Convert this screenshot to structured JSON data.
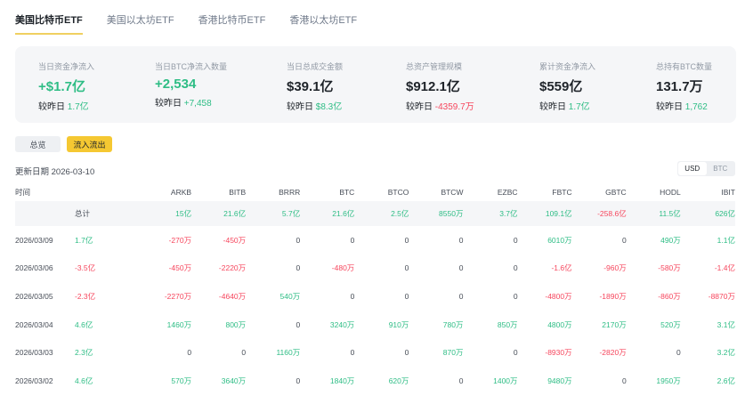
{
  "tabs": [
    "美国比特币ETF",
    "美国以太坊ETF",
    "香港比特币ETF",
    "香港以太坊ETF"
  ],
  "stats": [
    {
      "label": "当日资金净流入",
      "value": "+$1.7亿",
      "value_color": "g",
      "compare_label": "较昨日",
      "compare": "1.7亿",
      "compare_color": "g"
    },
    {
      "label": "当日BTC净流入数量",
      "value": "+2,534",
      "value_color": "g",
      "compare_label": "较昨日",
      "compare": "+7,458",
      "compare_color": "g"
    },
    {
      "label": "当日总成交金额",
      "value": "$39.1亿",
      "value_color": "",
      "compare_label": "较昨日",
      "compare": "$8.3亿",
      "compare_color": "g"
    },
    {
      "label": "总资产管理规模",
      "value": "$912.1亿",
      "value_color": "",
      "compare_label": "较昨日",
      "compare": "-4359.7万",
      "compare_color": "r"
    },
    {
      "label": "累计资金净流入",
      "value": "$559亿",
      "value_color": "",
      "compare_label": "较昨日",
      "compare": "1.7亿",
      "compare_color": "g"
    },
    {
      "label": "总持有BTC数量",
      "value": "131.7万",
      "value_color": "",
      "compare_label": "较昨日",
      "compare": "1,762",
      "compare_color": "g"
    }
  ],
  "buttons": {
    "overview": "总览",
    "flows": "流入流出"
  },
  "update": "更新日期 2026-03-10",
  "toggle": {
    "usd": "USD",
    "btc": "BTC"
  },
  "table": {
    "headers": [
      "时间",
      "",
      "ARKB",
      "BITB",
      "BRRR",
      "BTC",
      "BTCO",
      "BTCW",
      "EZBC",
      "FBTC",
      "GBTC",
      "HODL",
      "IBIT"
    ],
    "rows": [
      [
        "",
        "总计",
        "15亿",
        "21.6亿",
        "5.7亿",
        "21.6亿",
        "2.5亿",
        "8550万",
        "3.7亿",
        "109.1亿",
        "-258.6亿",
        "11.5亿",
        "626亿"
      ],
      [
        "2026/03/09",
        "1.7亿",
        "-270万",
        "-450万",
        "0",
        "0",
        "0",
        "0",
        "0",
        "6010万",
        "0",
        "490万",
        "1.1亿"
      ],
      [
        "2026/03/06",
        "-3.5亿",
        "-450万",
        "-2220万",
        "0",
        "-480万",
        "0",
        "0",
        "0",
        "-1.6亿",
        "-960万",
        "-580万",
        "-1.4亿"
      ],
      [
        "2026/03/05",
        "-2.3亿",
        "-2270万",
        "-4640万",
        "540万",
        "0",
        "0",
        "0",
        "0",
        "-4800万",
        "-1890万",
        "-860万",
        "-8870万"
      ],
      [
        "2026/03/04",
        "4.6亿",
        "1460万",
        "800万",
        "0",
        "3240万",
        "910万",
        "780万",
        "850万",
        "4800万",
        "2170万",
        "520万",
        "3.1亿"
      ],
      [
        "2026/03/03",
        "2.3亿",
        "0",
        "0",
        "1160万",
        "0",
        "0",
        "870万",
        "0",
        "-8930万",
        "-2820万",
        "0",
        "3.2亿"
      ],
      [
        "2026/03/02",
        "4.6亿",
        "570万",
        "3640万",
        "0",
        "1840万",
        "620万",
        "0",
        "1400万",
        "9480万",
        "0",
        "1950万",
        "2.6亿"
      ]
    ]
  }
}
